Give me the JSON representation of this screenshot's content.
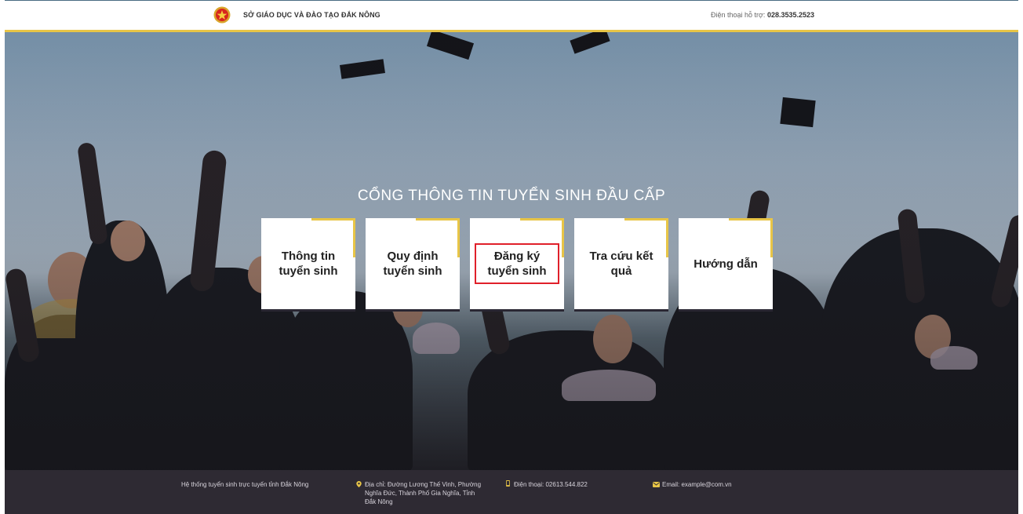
{
  "header": {
    "org_name": "SỞ GIÁO DỤC VÀ ĐÀO TẠO ĐẮK NÔNG",
    "support_label": "Điện thoại hỗ trợ:",
    "support_phone": "028.3535.2523"
  },
  "hero": {
    "title": "CỔNG THÔNG TIN TUYỂN SINH ĐẦU CẤP",
    "cards": [
      {
        "label": "Thông tin tuyển sinh"
      },
      {
        "label": "Quy định tuyển sinh"
      },
      {
        "label": "Đăng ký tuyển sinh"
      },
      {
        "label": "Tra cứu kết quả"
      },
      {
        "label": "Hướng dẫn"
      }
    ]
  },
  "footer": {
    "system_name": "Hệ thống tuyển sinh trực tuyến tỉnh Đắk Nông",
    "address": "Địa chỉ: Đường Lương Thế Vinh, Phường Nghĩa Đức, Thành Phố Gia Nghĩa, Tỉnh Đắk Nông",
    "phone": "Điện thoại: 02613.544.822",
    "email": "Email: example@com.vn"
  },
  "colors": {
    "accent": "#e8c547",
    "footer_bg": "#2e2a33",
    "highlight": "#e0202a"
  },
  "icons": [
    "emblem-icon",
    "location-pin-icon",
    "phone-icon",
    "mail-icon"
  ]
}
